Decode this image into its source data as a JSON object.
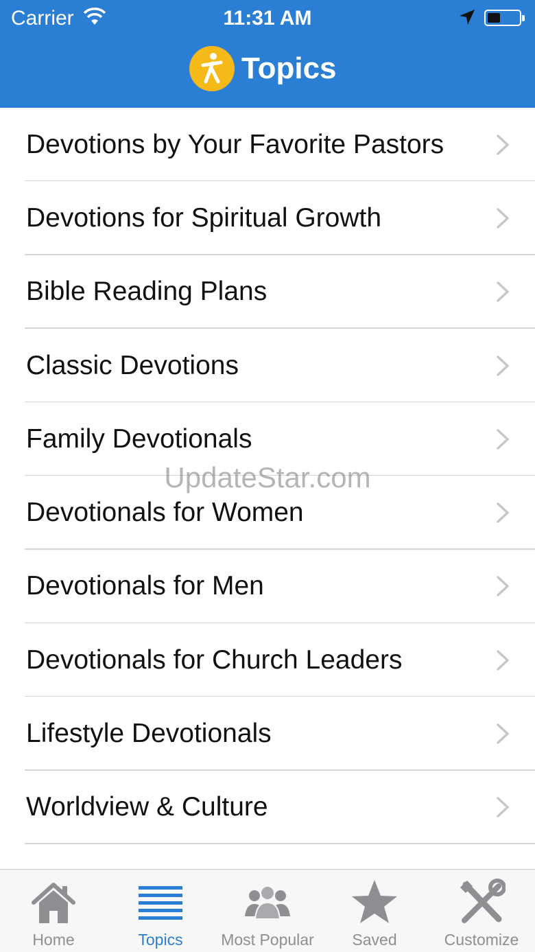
{
  "status_bar": {
    "carrier": "Carrier",
    "time": "11:31 AM"
  },
  "header": {
    "title": "Topics",
    "background_color": "#2a7fd4",
    "logo_color": "#f5b91a"
  },
  "topics": [
    {
      "label": "Devotions by Your Favorite Pastors"
    },
    {
      "label": "Devotions for Spiritual Growth"
    },
    {
      "label": "Bible Reading Plans"
    },
    {
      "label": "Classic Devotions"
    },
    {
      "label": "Family Devotionals"
    },
    {
      "label": "Devotionals for Women"
    },
    {
      "label": "Devotionals for Men"
    },
    {
      "label": "Devotionals for Church Leaders"
    },
    {
      "label": "Lifestyle Devotionals"
    },
    {
      "label": "Worldview & Culture"
    }
  ],
  "watermark": "UpdateStar.com",
  "tab_bar": {
    "tabs": [
      {
        "label": "Home",
        "icon": "home-icon"
      },
      {
        "label": "Topics",
        "icon": "list-icon",
        "active": true
      },
      {
        "label": "Most Popular",
        "icon": "people-icon"
      },
      {
        "label": "Saved",
        "icon": "star-icon"
      },
      {
        "label": "Customize",
        "icon": "tools-icon"
      }
    ],
    "active_color": "#2a7fd4",
    "inactive_color": "#8e8e93"
  }
}
